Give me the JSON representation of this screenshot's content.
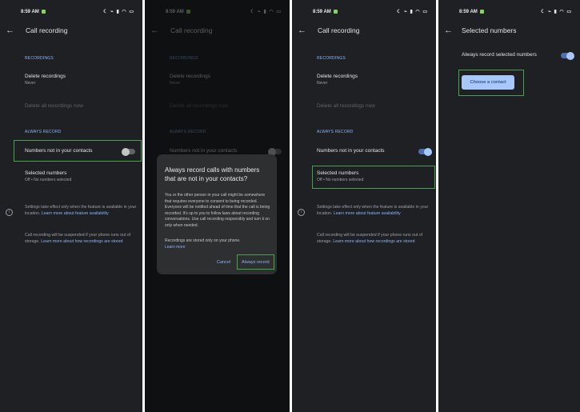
{
  "status": {
    "time": "8:59 AM",
    "icons": "☾ ⌁ ▮ ◠ ▭"
  },
  "call_recording": {
    "title": "Call recording",
    "recordings_header": "RECORDINGS",
    "delete_recordings": "Delete recordings",
    "delete_recordings_value": "Never",
    "delete_all": "Delete all recordings now",
    "always_record_header": "ALWAYS RECORD",
    "numbers_not_in_contacts": "Numbers not in your contacts",
    "selected_numbers": "Selected numbers",
    "selected_numbers_value": "Off • No numbers selected",
    "note1_text": "Settings take effect only when the feature is available in your location. ",
    "note1_link": "Learn more about feature availability",
    "note2_text": "Call recording will be suspended if your phone runs out of storage. ",
    "note2_link": "Learn more about how recordings are stored"
  },
  "dialog": {
    "title": "Always record calls with numbers that are not in your contacts?",
    "body": "You or the other person in your call might be somewhere that requires everyone to consent to being recorded. Everyone will be notified ahead of time that the call is being recorded. It's up to you to follow laws about recording conversations. Use call recording responsibly and turn it on only when needed.",
    "body2": "Recordings are stored only on your phone.",
    "link": "Learn more",
    "cancel": "Cancel",
    "confirm": "Always record"
  },
  "selected_numbers_page": {
    "title": "Selected numbers",
    "always_record_label": "Always record selected numbers",
    "choose_contact": "Choose a contact"
  },
  "toggles": {
    "p1_numbers": "off",
    "p3_numbers": "on",
    "p4_selected": "on"
  }
}
